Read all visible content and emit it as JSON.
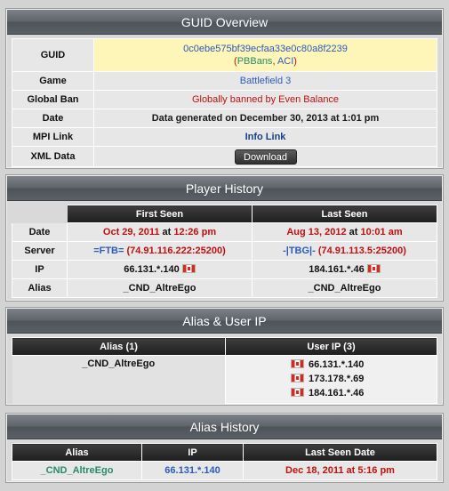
{
  "guid_overview": {
    "title": "GUID Overview",
    "rows": {
      "guid_label": "GUID",
      "guid_value": "0c0ebe575bf39ecfaa33e0c80a8f2239",
      "guid_open": "(",
      "pbbans": "PBBans",
      "sep": ", ",
      "aci": "ACI",
      "guid_close": ")",
      "game_label": "Game",
      "game_value": "Battlefield 3",
      "ban_label": "Global Ban",
      "ban_value": "Globally banned by Even Balance",
      "date_label": "Date",
      "date_value": "Data generated on December 30, 2013 at 1:01 pm",
      "mpi_label": "MPI Link",
      "mpi_value": "Info Link",
      "xml_label": "XML Data",
      "xml_button": "Download"
    }
  },
  "player_history": {
    "title": "Player History",
    "headers": [
      "First Seen",
      "Last Seen"
    ],
    "date_label": "Date",
    "first_date": "Oct 29, 2011",
    "first_time": "12:26 pm",
    "last_date": "Aug 13, 2012",
    "last_time": "10:01 am",
    "at": " at ",
    "server_label": "Server",
    "first_server_tag": "=FTB=",
    "first_server_addr": " (74.91.116.222:25200)",
    "last_server_tag": "-|TBG|-",
    "last_server_addr": " (74.91.113.5:25200)",
    "ip_label": "IP",
    "first_ip": "66.131.*.140",
    "last_ip": "184.161.*.46",
    "alias_label": "Alias",
    "first_alias": "_CND_AltreEgo",
    "last_alias": "_CND_AltreEgo"
  },
  "alias_user_ip": {
    "title": "Alias & User IP",
    "headers": [
      "Alias (1)",
      "User IP (3)"
    ],
    "alias": "_CND_AltreEgo",
    "ips": [
      "66.131.*.140",
      "173.178.*.69",
      "184.161.*.46"
    ]
  },
  "alias_history": {
    "title": "Alias History",
    "headers": [
      "Alias",
      "IP",
      "Last Seen Date"
    ],
    "rows": [
      {
        "alias": "_CND_AltreEgo",
        "ip": "66.131.*.140",
        "date": "Dec 18, 2011",
        "time": "5:16 pm"
      }
    ],
    "at": " at "
  },
  "colors": {
    "header_bar": "#5d6369",
    "table_header": "#2a2a2a",
    "cell": "#e7e7e7",
    "guid_highlight": "#fdf6b8",
    "link_blue": "#2f5bb8",
    "alert_red": "#c01010"
  },
  "icons": {
    "flag": "canada-flag-icon"
  }
}
